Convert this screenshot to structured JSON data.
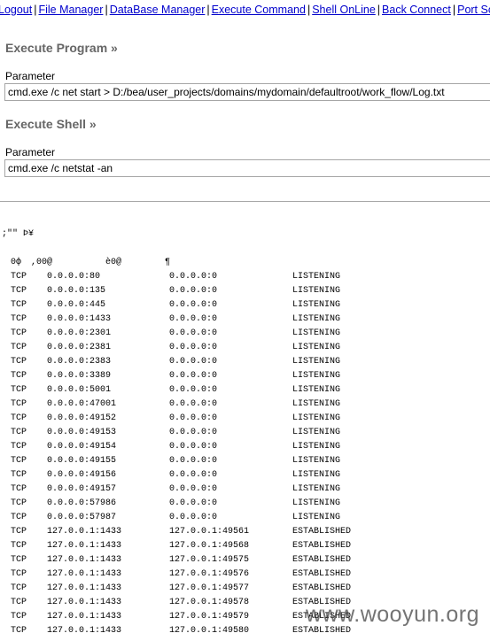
{
  "nav": [
    "Logout",
    "File Manager",
    "DataBase Manager",
    "Execute Command",
    "Shell OnLine",
    "Back Connect",
    "Port Sc"
  ],
  "program": {
    "heading": "Execute Program »",
    "label": "Parameter",
    "value": "cmd.exe /c net start > D:/bea/user_projects/domains/mydomain/defaultroot/work_flow/Log.txt"
  },
  "shell": {
    "heading": "Execute Shell »",
    "label": "Parameter",
    "value": "cmd.exe /c netstat -an"
  },
  "output": {
    "garbled_line": ";\"\" Þ¥",
    "header": [
      "0ф",
      ",00@",
      "è0@",
      "¶"
    ],
    "rows": [
      [
        "TCP",
        "0.0.0.0:80",
        "0.0.0.0:0",
        "LISTENING"
      ],
      [
        "TCP",
        "0.0.0.0:135",
        "0.0.0.0:0",
        "LISTENING"
      ],
      [
        "TCP",
        "0.0.0.0:445",
        "0.0.0.0:0",
        "LISTENING"
      ],
      [
        "TCP",
        "0.0.0.0:1433",
        "0.0.0.0:0",
        "LISTENING"
      ],
      [
        "TCP",
        "0.0.0.0:2301",
        "0.0.0.0:0",
        "LISTENING"
      ],
      [
        "TCP",
        "0.0.0.0:2381",
        "0.0.0.0:0",
        "LISTENING"
      ],
      [
        "TCP",
        "0.0.0.0:2383",
        "0.0.0.0:0",
        "LISTENING"
      ],
      [
        "TCP",
        "0.0.0.0:3389",
        "0.0.0.0:0",
        "LISTENING"
      ],
      [
        "TCP",
        "0.0.0.0:5001",
        "0.0.0.0:0",
        "LISTENING"
      ],
      [
        "TCP",
        "0.0.0.0:47001",
        "0.0.0.0:0",
        "LISTENING"
      ],
      [
        "TCP",
        "0.0.0.0:49152",
        "0.0.0.0:0",
        "LISTENING"
      ],
      [
        "TCP",
        "0.0.0.0:49153",
        "0.0.0.0:0",
        "LISTENING"
      ],
      [
        "TCP",
        "0.0.0.0:49154",
        "0.0.0.0:0",
        "LISTENING"
      ],
      [
        "TCP",
        "0.0.0.0:49155",
        "0.0.0.0:0",
        "LISTENING"
      ],
      [
        "TCP",
        "0.0.0.0:49156",
        "0.0.0.0:0",
        "LISTENING"
      ],
      [
        "TCP",
        "0.0.0.0:49157",
        "0.0.0.0:0",
        "LISTENING"
      ],
      [
        "TCP",
        "0.0.0.0:57986",
        "0.0.0.0:0",
        "LISTENING"
      ],
      [
        "TCP",
        "0.0.0.0:57987",
        "0.0.0.0:0",
        "LISTENING"
      ],
      [
        "TCP",
        "127.0.0.1:1433",
        "127.0.0.1:49561",
        "ESTABLISHED"
      ],
      [
        "TCP",
        "127.0.0.1:1433",
        "127.0.0.1:49568",
        "ESTABLISHED"
      ],
      [
        "TCP",
        "127.0.0.1:1433",
        "127.0.0.1:49575",
        "ESTABLISHED"
      ],
      [
        "TCP",
        "127.0.0.1:1433",
        "127.0.0.1:49576",
        "ESTABLISHED"
      ],
      [
        "TCP",
        "127.0.0.1:1433",
        "127.0.0.1:49577",
        "ESTABLISHED"
      ],
      [
        "TCP",
        "127.0.0.1:1433",
        "127.0.0.1:49578",
        "ESTABLISHED"
      ],
      [
        "TCP",
        "127.0.0.1:1433",
        "127.0.0.1:49579",
        "ESTABLISHED"
      ],
      [
        "TCP",
        "127.0.0.1:1433",
        "127.0.0.1:49580",
        "ESTABLISHED"
      ]
    ]
  },
  "watermark": "www.wooyun.org"
}
